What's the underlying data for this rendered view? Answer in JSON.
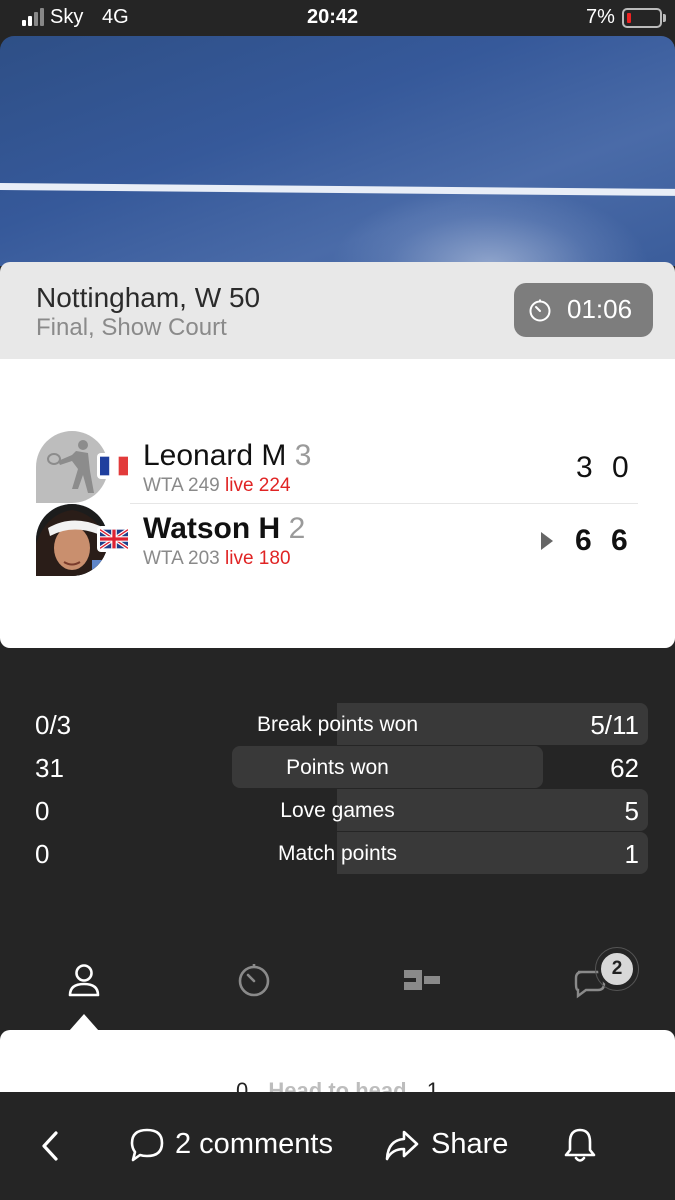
{
  "status_bar": {
    "carrier": "Sky",
    "network": "4G",
    "time": "20:42",
    "battery": "7%"
  },
  "event": {
    "title": "Nottingham, W 50",
    "subtitle": "Final, Show Court",
    "duration": "01:06"
  },
  "players": [
    {
      "name": "Leonard M",
      "seed": "3",
      "ranking": "WTA 249",
      "live_ranking": "live 224",
      "flag": "france",
      "sets": [
        "3",
        "0"
      ],
      "serving": false,
      "winner": false
    },
    {
      "name": "Watson H",
      "seed": "2",
      "ranking": "WTA 203",
      "live_ranking": "live 180",
      "flag": "united-kingdom",
      "sets": [
        "6",
        "6"
      ],
      "serving": true,
      "winner": true
    }
  ],
  "stats": [
    {
      "left": "0/3",
      "label": "Break points won",
      "right": "5/11",
      "right_share": 0.5
    },
    {
      "left": "31",
      "label": "Points won",
      "right": "62",
      "left_share": 0.33
    },
    {
      "left": "0",
      "label": "Love games",
      "right": "5",
      "right_share": 0.5
    },
    {
      "left": "0",
      "label": "Match points",
      "right": "1",
      "right_share": 0.5
    }
  ],
  "tabs": [
    {
      "icon": "person-icon",
      "active": true
    },
    {
      "icon": "stopwatch-icon",
      "active": false
    },
    {
      "icon": "bracket-icon",
      "active": false
    },
    {
      "icon": "chat-bubbles-icon",
      "active": false,
      "badge": "2"
    }
  ],
  "head_to_head": {
    "left": "0",
    "label": "Head to head",
    "right": "1"
  },
  "actions": {
    "comments": "2 comments",
    "share": "Share"
  }
}
